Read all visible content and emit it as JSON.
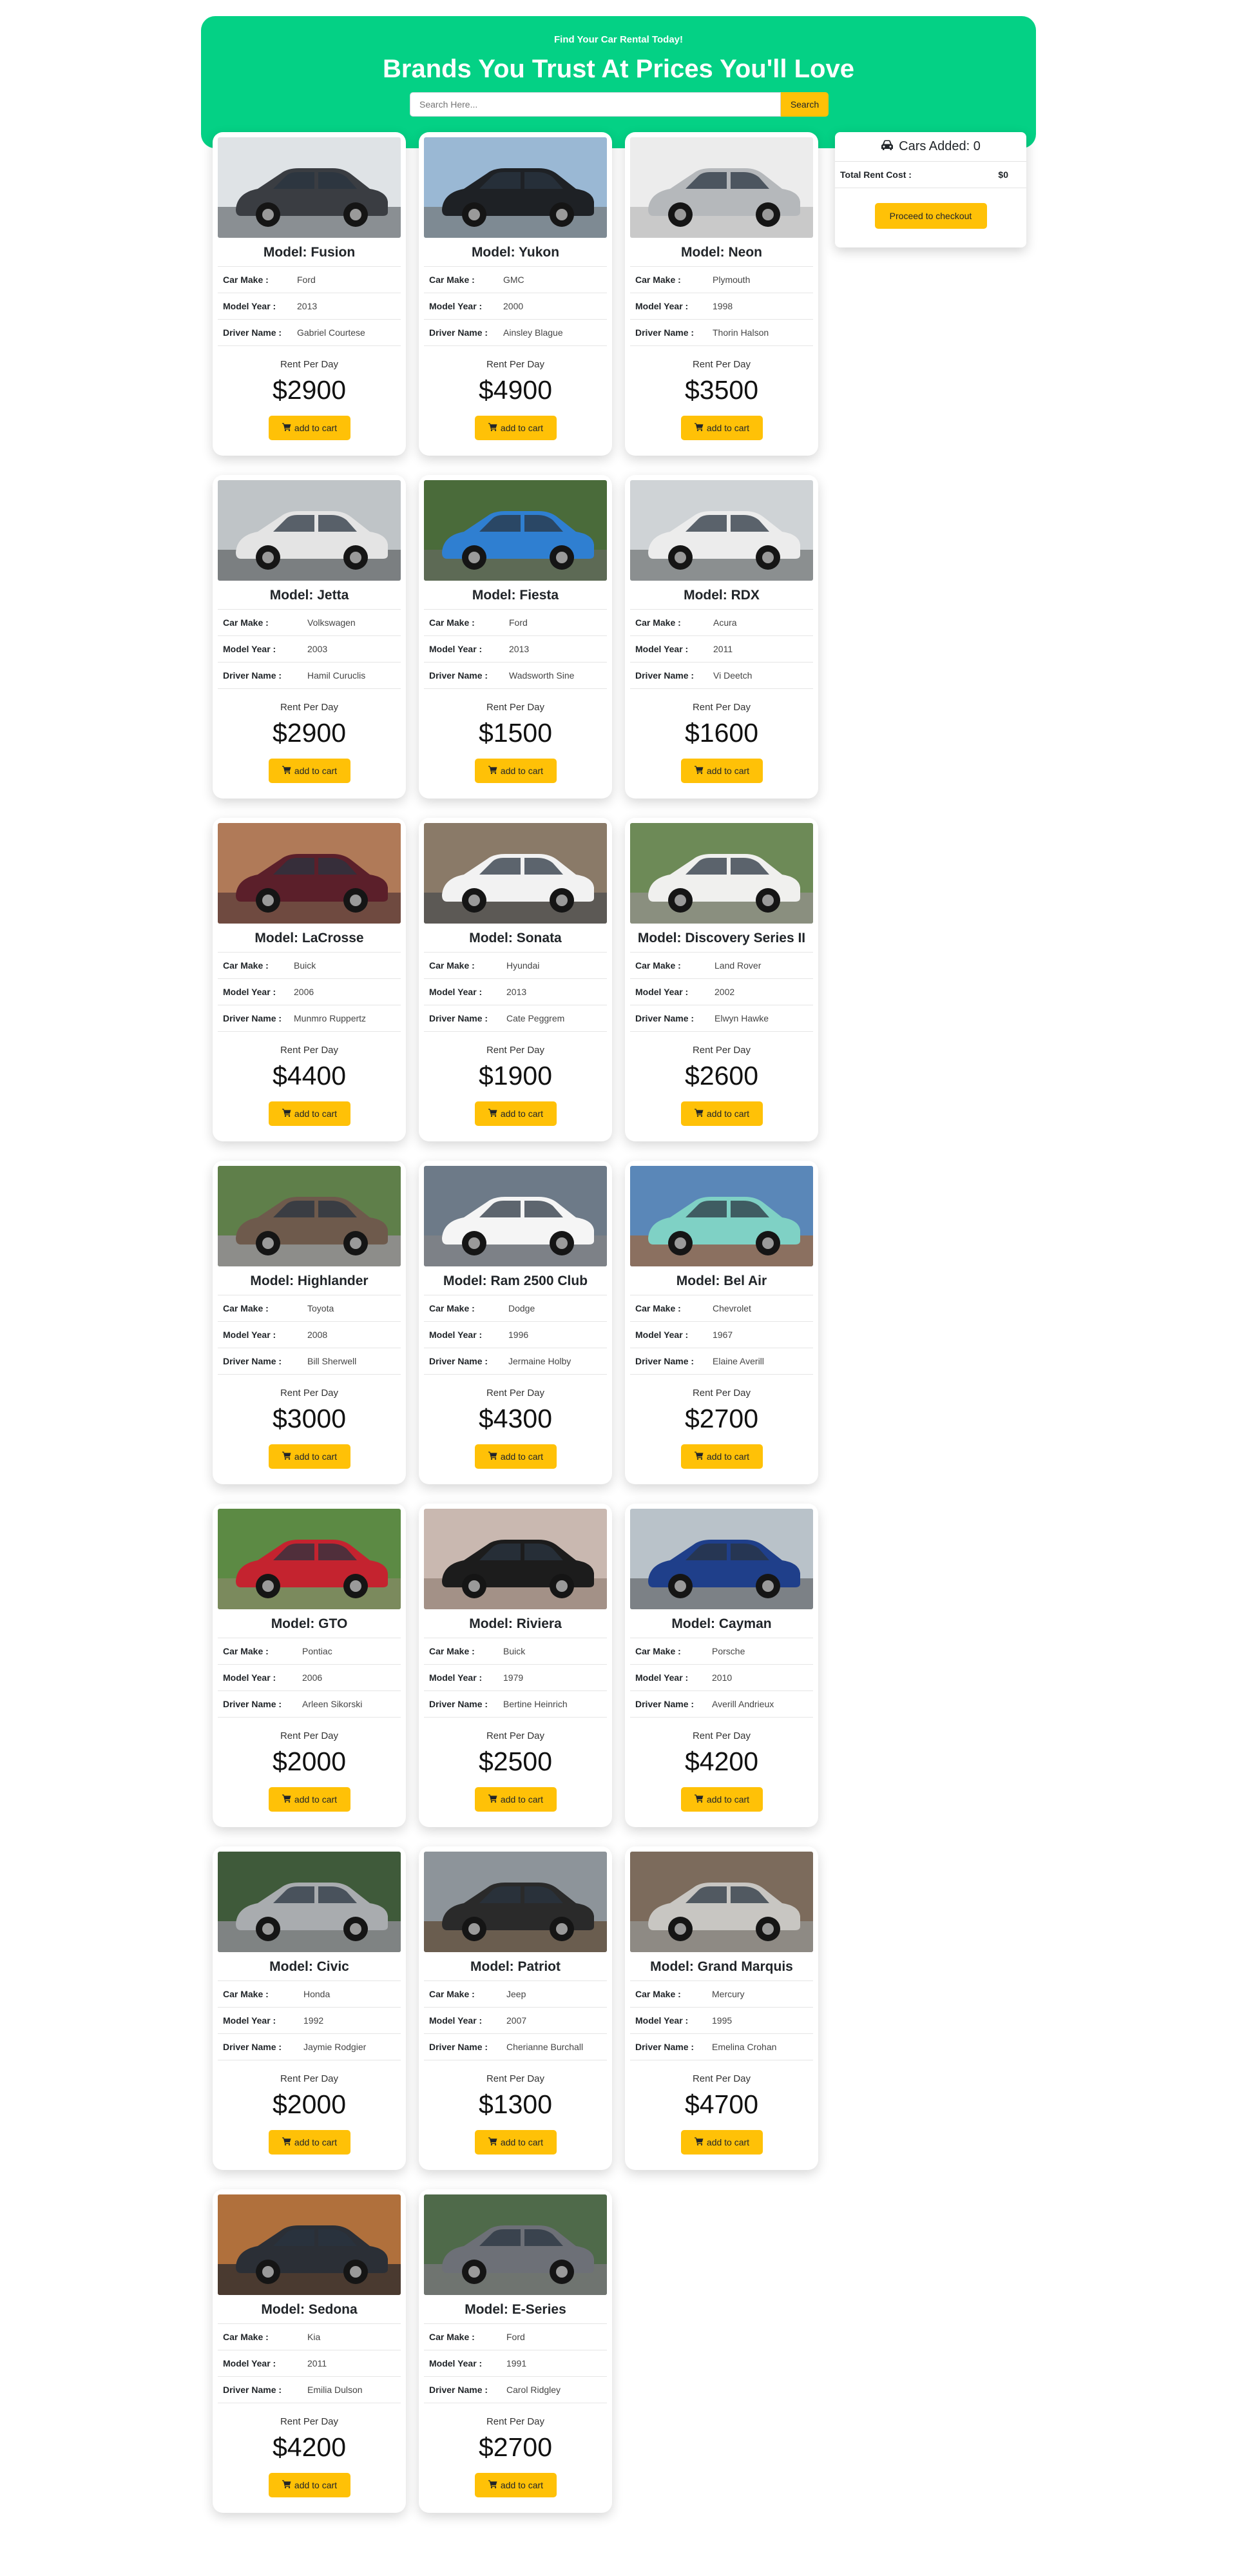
{
  "header": {
    "tagline": "Find Your Car Rental Today!",
    "headline": "Brands You Trust At Prices You'll Love",
    "search_placeholder": "Search Here...",
    "search_button": "Search"
  },
  "cart": {
    "icon": "car-icon",
    "cars_added_label": "Cars Added: 0",
    "total_label": "Total Rent Cost :",
    "total_value": "$0",
    "checkout_label": "Proceed to checkout"
  },
  "labels": {
    "make": "Car Make :",
    "year": "Model Year :",
    "driver": "Driver Name :",
    "rent_per_day": "Rent Per Day",
    "add_to_cart": "add to cart",
    "cart_icon": "shopping-cart-icon"
  },
  "colors": {
    "accent_green": "#04d185",
    "button_yellow": "#ffc107"
  },
  "cars": [
    {
      "model": "Model: Fusion",
      "make": "Ford",
      "year": "2013",
      "driver": "Gabriel Courtese",
      "price": "$2900",
      "color": "#3a3d42",
      "sky": "#dfe3e6",
      "ground": "#8a8f93"
    },
    {
      "model": "Model: Yukon",
      "make": "GMC",
      "year": "2000",
      "driver": "Ainsley Blague",
      "price": "$4900",
      "color": "#1e2125",
      "sky": "#9ab8d4",
      "ground": "#7e8a93"
    },
    {
      "model": "Model: Neon",
      "make": "Plymouth",
      "year": "1998",
      "driver": "Thorin Halson",
      "price": "$3500",
      "color": "#b5b8bb",
      "sky": "#ececec",
      "ground": "#c9c9c9"
    },
    {
      "model": "Model: Jetta",
      "make": "Volkswagen",
      "year": "2003",
      "driver": "Hamil Curuclis",
      "price": "$2900",
      "color": "#e4e4e4",
      "sky": "#bfc4c7",
      "ground": "#7b7f81"
    },
    {
      "model": "Model: Fiesta",
      "make": "Ford",
      "year": "2013",
      "driver": "Wadsworth Sine",
      "price": "$1500",
      "color": "#2f7fd1",
      "sky": "#4a6b3a",
      "ground": "#5d6a55"
    },
    {
      "model": "Model: RDX",
      "make": "Acura",
      "year": "2011",
      "driver": "Vi Deetch",
      "price": "$1600",
      "color": "#ececec",
      "sky": "#cfd3d6",
      "ground": "#8b8f90"
    },
    {
      "model": "Model: LaCrosse",
      "make": "Buick",
      "year": "2006",
      "driver": "Munmro Ruppertz",
      "price": "$4400",
      "color": "#5b1f2a",
      "sky": "#b07a58",
      "ground": "#6f4a40"
    },
    {
      "model": "Model: Sonata",
      "make": "Hyundai",
      "year": "2013",
      "driver": "Cate Peggrem",
      "price": "$1900",
      "color": "#f2f2f2",
      "sky": "#8a7a68",
      "ground": "#5c5955"
    },
    {
      "model": "Model: Discovery Series II",
      "make": "Land Rover",
      "year": "2002",
      "driver": "Elwyn Hawke",
      "price": "$2600",
      "color": "#f0f0ee",
      "sky": "#6d8a57",
      "ground": "#8a8f7f"
    },
    {
      "model": "Model: Highlander",
      "make": "Toyota",
      "year": "2008",
      "driver": "Bill Sherwell",
      "price": "$3000",
      "color": "#6e5a4c",
      "sky": "#5f7f4a",
      "ground": "#8d8d8a"
    },
    {
      "model": "Model: Ram 2500 Club",
      "make": "Dodge",
      "year": "1996",
      "driver": "Jermaine Holby",
      "price": "$4300",
      "color": "#f5f5f5",
      "sky": "#6d7a88",
      "ground": "#7d8187"
    },
    {
      "model": "Model: Bel Air",
      "make": "Chevrolet",
      "year": "1967",
      "driver": "Elaine Averill",
      "price": "$2700",
      "color": "#7fd1c5",
      "sky": "#5a87b8",
      "ground": "#8b7060"
    },
    {
      "model": "Model: GTO",
      "make": "Pontiac",
      "year": "2006",
      "driver": "Arleen Sikorski",
      "price": "$2000",
      "color": "#c4232f",
      "sky": "#5c8a44",
      "ground": "#7b8a5d"
    },
    {
      "model": "Model: Riviera",
      "make": "Buick",
      "year": "1979",
      "driver": "Bertine Heinrich",
      "price": "$2500",
      "color": "#1c1c1c",
      "sky": "#c9b8b0",
      "ground": "#a39187"
    },
    {
      "model": "Model: Cayman",
      "make": "Porsche",
      "year": "2010",
      "driver": "Averill Andrieux",
      "price": "$4200",
      "color": "#1f3f8a",
      "sky": "#b9c2c9",
      "ground": "#7c8186"
    },
    {
      "model": "Model: Civic",
      "make": "Honda",
      "year": "1992",
      "driver": "Jaymie Rodgier",
      "price": "$2000",
      "color": "#a9acaf",
      "sky": "#3f5a3a",
      "ground": "#7f8383"
    },
    {
      "model": "Model: Patriot",
      "make": "Jeep",
      "year": "2007",
      "driver": "Cherianne Burchall",
      "price": "$1300",
      "color": "#2a2a2a",
      "sky": "#8d949a",
      "ground": "#6a5d4f"
    },
    {
      "model": "Model: Grand Marquis",
      "make": "Mercury",
      "year": "1995",
      "driver": "Emelina Crohan",
      "price": "$4700",
      "color": "#c8c6c2",
      "sky": "#7c6b5c",
      "ground": "#8e8a84"
    },
    {
      "model": "Model: Sedona",
      "make": "Kia",
      "year": "2011",
      "driver": "Emilia Dulson",
      "price": "$4200",
      "color": "#2b2f36",
      "sky": "#b0703c",
      "ground": "#4a3a30"
    },
    {
      "model": "Model: E-Series",
      "make": "Ford",
      "year": "1991",
      "driver": "Carol Ridgley",
      "price": "$2700",
      "color": "#6d7077",
      "sky": "#4f6a4a",
      "ground": "#6f7470"
    }
  ]
}
